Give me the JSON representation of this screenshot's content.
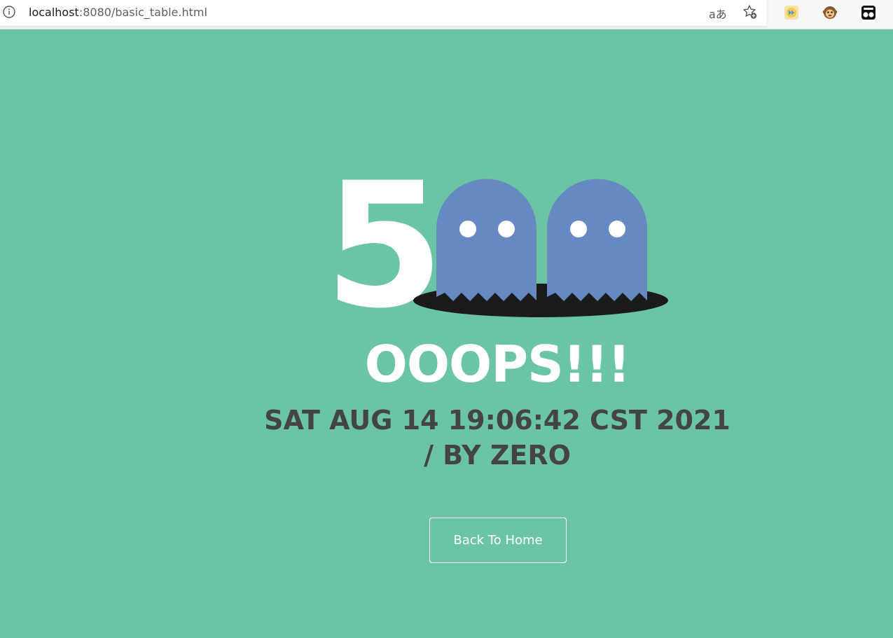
{
  "browser": {
    "url_host": "localhost",
    "url_rest": ":8080/basic_table.html",
    "read_aloud_label": "aあ",
    "icons": [
      "info-icon",
      "read-aloud-icon",
      "favorite-add-icon",
      "fast-forward-extension-icon",
      "monkey-extension-icon",
      "tampermonkey-extension-icon"
    ]
  },
  "error": {
    "code_digit": "5",
    "title": "OOOPS!!!",
    "detail_line1": "SAT AUG 14 19:06:42 CST 2021",
    "detail_line2": "/ BY ZERO",
    "button_label": "Back To Home"
  },
  "colors": {
    "background": "#6bc5a4",
    "ghost": "#6789c1",
    "hole": "#1b1b1b",
    "detail_text": "#444444"
  }
}
